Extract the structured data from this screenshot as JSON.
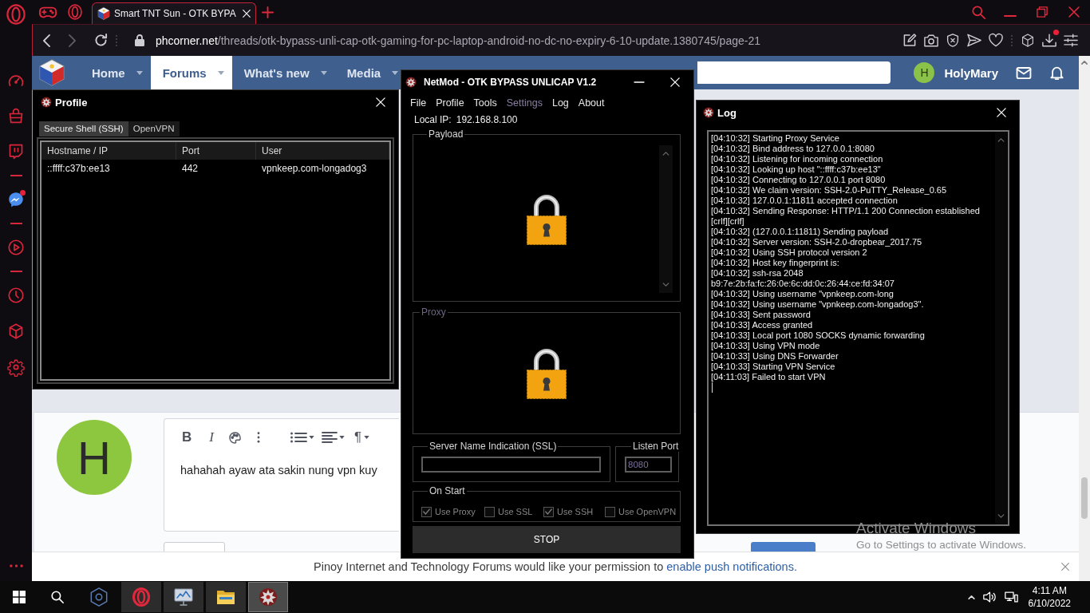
{
  "browser": {
    "sidebar": [
      {
        "kind": "speedometer",
        "badge": false
      },
      {
        "kind": "bag",
        "badge": false
      },
      {
        "kind": "twitch",
        "badge": false
      },
      {
        "kind": "divider"
      },
      {
        "kind": "messenger",
        "badge": true
      },
      {
        "kind": "divider"
      },
      {
        "kind": "player",
        "badge": false
      },
      {
        "kind": "divider"
      },
      {
        "kind": "history",
        "badge": false
      },
      {
        "kind": "cube",
        "badge": false
      },
      {
        "kind": "settings",
        "badge": false
      }
    ],
    "tabs": [
      {
        "title": "Smart TNT Sun - OTK BYPA",
        "selected": true
      }
    ],
    "address": {
      "host": "phcorner.net",
      "path": "/threads/otk-bypass-unli-cap-otk-gaming-for-pc-laptop-android-no-dc-no-expiry-6-10-update.1380745/page-21"
    },
    "toolbar": [
      {
        "kind": "snapshot",
        "badge": false
      },
      {
        "kind": "camera",
        "badge": false
      },
      {
        "kind": "shield",
        "badge": false
      },
      {
        "kind": "send",
        "badge": false
      },
      {
        "kind": "heart",
        "badge": false
      },
      {
        "kind": "divider"
      },
      {
        "kind": "cube",
        "badge": false
      },
      {
        "kind": "download",
        "badge": true
      },
      {
        "kind": "sliders",
        "badge": false
      }
    ]
  },
  "site": {
    "nav": [
      {
        "label": "Home",
        "selected": false
      },
      {
        "label": "Forums",
        "selected": true
      },
      {
        "label": "What's new",
        "selected": false
      },
      {
        "label": "Media",
        "selected": false
      }
    ],
    "user": {
      "initial": "H",
      "name": "HolyMary"
    },
    "reply": {
      "avatar_initial": "H",
      "toolbar": [
        {
          "kind": "bold",
          "label": "B",
          "menu": false
        },
        {
          "kind": "italic",
          "label": "I",
          "menu": false
        },
        {
          "kind": "palette",
          "menu": false
        },
        {
          "kind": "more",
          "menu": false
        },
        {
          "kind": "list",
          "menu": true
        },
        {
          "kind": "align",
          "menu": true
        },
        {
          "kind": "paragraph",
          "label": "¶",
          "menu": true
        }
      ],
      "text": "hahahah ayaw ata sakin nung vpn kuy"
    },
    "notification": {
      "text": "Pinoy Internet and Technology Forums would like your permission to",
      "link": "enable push notifications."
    }
  },
  "profile_window": {
    "title": "Profile",
    "tabs": [
      {
        "label": "Secure Shell (SSH)",
        "selected": true
      },
      {
        "label": "OpenVPN",
        "selected": false
      }
    ],
    "columns": [
      "Hostname / IP",
      "Port",
      "User"
    ],
    "rows": [
      [
        "::ffff:c37b:ee13",
        "442",
        "vpnkeep.com-longadog3"
      ]
    ]
  },
  "netmod_window": {
    "title": "NetMod - OTK BYPASS UNLICAP V1.2",
    "menu": [
      {
        "label": "File",
        "disabled": false
      },
      {
        "label": "Profile",
        "disabled": false
      },
      {
        "label": "Tools",
        "disabled": false
      },
      {
        "label": "Settings",
        "disabled": true
      },
      {
        "label": "Log",
        "disabled": false
      },
      {
        "label": "About",
        "disabled": false
      }
    ],
    "local_ip": {
      "label": "Local IP:",
      "value": "192.168.8.100"
    },
    "payload": {
      "label": "Payload",
      "disabled": false,
      "locked": true
    },
    "proxy": {
      "label": "Proxy",
      "disabled": true,
      "locked": true
    },
    "sni": {
      "label": "Server Name Indication (SSL)"
    },
    "listen_port": {
      "label": "Listen Port",
      "value": "8080",
      "disabled": true
    },
    "on_start": {
      "label": "On Start",
      "options": [
        {
          "label": "Use Proxy",
          "checked": true,
          "disabled": true
        },
        {
          "label": "Use SSL",
          "checked": false,
          "disabled": true
        },
        {
          "label": "Use SSH",
          "checked": true,
          "disabled": true
        },
        {
          "label": "Use OpenVPN",
          "checked": false,
          "disabled": true
        }
      ]
    },
    "button": "STOP"
  },
  "log_window": {
    "title": "Log",
    "lines": [
      "[04:10:32] Starting Proxy Service",
      "[04:10:32] Bind address to 127.0.0.1:8080",
      "[04:10:32] Listening for incoming connection",
      "[04:10:32] Looking up host \"::ffff:c37b:ee13\"",
      "[04:10:32] Connecting to 127.0.0.1 port 8080",
      "[04:10:32] We claim version: SSH-2.0-PuTTY_Release_0.65",
      "[04:10:32] 127.0.0.1:11811 accepted connection",
      "[04:10:32] Sending Response: HTTP/1.1 200 Connection established",
      "[crlf][crlf]",
      "[04:10:32] (127.0.0.1:11811) Sending payload",
      "[04:10:32] Server version: SSH-2.0-dropbear_2017.75",
      "[04:10:32] Using SSH protocol version 2",
      "[04:10:32] Host key fingerprint is:",
      "[04:10:32] ssh-rsa 2048",
      "b9:7e:2b:fa:fc:26:0e:6c:dd:0c:26:44:ce:fd:34:07",
      "[04:10:32] Using username \"vpnkeep.com-long",
      "[04:10:32] Using username \"vpnkeep.com-longadog3\".",
      "[04:10:33] Sent password",
      "[04:10:33] Access granted",
      "[04:10:33] Local port 1080 SOCKS dynamic forwarding",
      "[04:10:33] Using VPN mode",
      "[04:10:33] Using DNS Forwarder",
      "[04:10:33] Starting VPN Service",
      "[04:11:03] Failed to start VPN"
    ]
  },
  "activation_notice": {
    "title": "Activate Windows",
    "text": "Go to Settings to activate Windows."
  },
  "taskbar": {
    "apps": [
      {
        "kind": "hexagon",
        "running": false,
        "active": false
      },
      {
        "kind": "browser",
        "running": true,
        "active": false
      },
      {
        "kind": "monitor",
        "running": true,
        "active": false
      },
      {
        "kind": "folder",
        "running": true,
        "active": false
      },
      {
        "kind": "emblem",
        "running": true,
        "active": true
      }
    ],
    "time": "4:11 AM",
    "date": "6/10/2022"
  }
}
